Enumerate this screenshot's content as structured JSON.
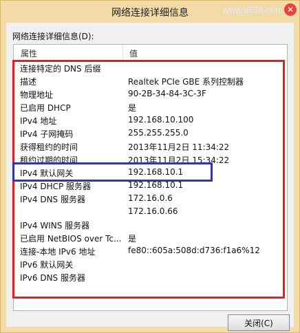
{
  "window": {
    "title": "网络连接详细信息",
    "watermark": "www.it528.com",
    "close_glyph": "✕"
  },
  "dialog": {
    "label": "网络连接详细信息(D):",
    "columns": [
      "属性",
      "值"
    ],
    "rows": [
      {
        "property": "连接特定的 DNS 后缀",
        "value": ""
      },
      {
        "property": "描述",
        "value": "Realtek PCIe GBE 系列控制器"
      },
      {
        "property": "物理地址",
        "value": "90-2B-34-84-3C-3F"
      },
      {
        "property": "已启用 DHCP",
        "value": "是"
      },
      {
        "property": "IPv4 地址",
        "value": "192.168.10.100"
      },
      {
        "property": "IPv4 子网掩码",
        "value": "255.255.255.0"
      },
      {
        "property": "获得租约的时间",
        "value": "2013年11月2日 11:34:22"
      },
      {
        "property": "租约过期的时间",
        "value": "2013年11月2日 15:34:22"
      },
      {
        "property": "IPv4 默认网关",
        "value": "192.168.10.1"
      },
      {
        "property": "IPv4 DHCP 服务器",
        "value": "192.168.10.1"
      },
      {
        "property": "IPv4 DNS 服务器",
        "value": "172.16.0.6"
      },
      {
        "property": "",
        "value": "172.16.0.66"
      },
      {
        "property": "IPv4 WINS 服务器",
        "value": ""
      },
      {
        "property": "已启用 NetBIOS over Tc...",
        "value": "是"
      },
      {
        "property": "连接-本地 IPv6 地址",
        "value": "fe80::605a:508d:d736:f1a6%12"
      },
      {
        "property": "IPv6 默认网关",
        "value": ""
      },
      {
        "property": "IPv6 DNS 服务器",
        "value": ""
      }
    ],
    "close_button": "关闭(C)"
  },
  "annotations": {
    "red_box_color": "#e51e1e",
    "blue_box_color": "#3434b2"
  }
}
